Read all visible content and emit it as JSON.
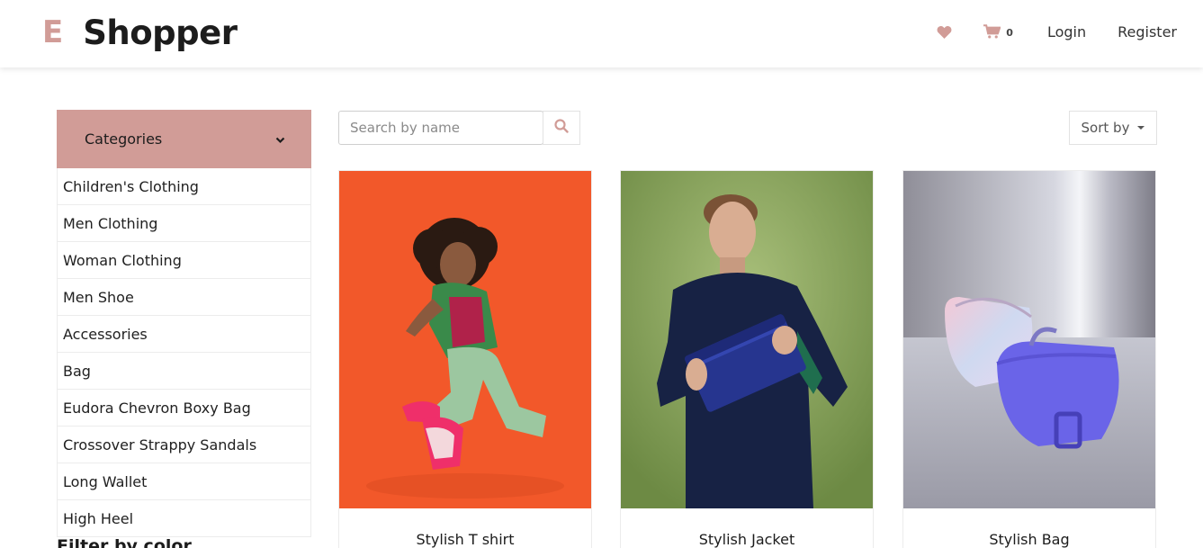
{
  "header": {
    "brand_letter": "E",
    "brand_name": "Shopper",
    "wishlist_icon": "heart-icon",
    "cart_icon": "shopping-cart-icon",
    "cart_count": "0",
    "login_label": "Login",
    "register_label": "Register"
  },
  "sidebar": {
    "categories_label": "Categories",
    "items": [
      {
        "label": "Children's Clothing"
      },
      {
        "label": "Men Clothing"
      },
      {
        "label": "Woman Clothing"
      },
      {
        "label": "Men Shoe"
      },
      {
        "label": "Accessories"
      },
      {
        "label": "Bag"
      },
      {
        "label": "Eudora Chevron Boxy Bag"
      },
      {
        "label": "Crossover Strappy Sandals"
      },
      {
        "label": "Long Wallet"
      },
      {
        "label": "High Heel"
      }
    ],
    "filter_heading": "Filter by color"
  },
  "toolbar": {
    "search_placeholder": "Search by name",
    "search_icon": "search-icon",
    "sort_label": "Sort by"
  },
  "products": [
    {
      "name": "Stylish T shirt"
    },
    {
      "name": "Stylish Jacket"
    },
    {
      "name": "Stylish Bag"
    }
  ],
  "colors": {
    "accent": "#D19C97",
    "text": "#1c1c1c"
  }
}
